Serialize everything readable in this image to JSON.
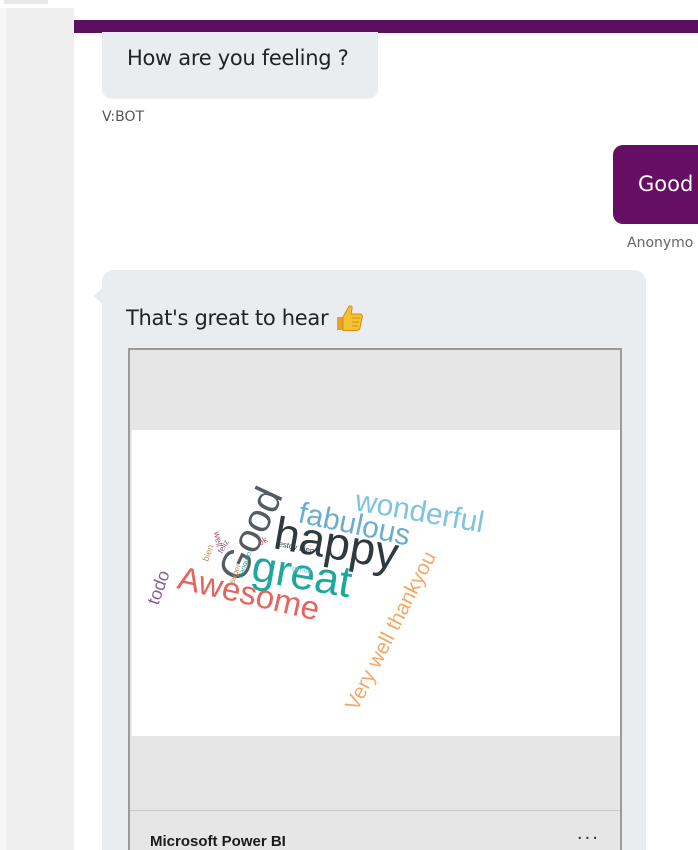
{
  "colors": {
    "accent": "#5b0f5e",
    "user_bubble": "#660e63",
    "bot_bubble": "#eaedf0"
  },
  "conversation": {
    "bot_message_1": "How are you feeling ?",
    "bot_label": "V:BOT",
    "user_message": "Good",
    "user_label": "Anonymo",
    "bot_message_2": "That's great to hear",
    "bot_message_2_icon": "thumbs-up-icon"
  },
  "card": {
    "title": "Microsoft Power BI",
    "more_label": "···"
  },
  "wordcloud": {
    "words": [
      {
        "text": "wonderful",
        "color": "#7fc4df"
      },
      {
        "text": "fabulous",
        "color": "#6aaecf"
      },
      {
        "text": "happy",
        "color": "#2d3a40"
      },
      {
        "text": "Good",
        "color": "#555c61"
      },
      {
        "text": "great",
        "color": "#1ea79b"
      },
      {
        "text": "Awesome",
        "color": "#e4645f"
      },
      {
        "text": "todo",
        "color": "#8a5e96"
      },
      {
        "text": "Very well thankyou",
        "color": "#f2a96a"
      },
      {
        "text": "bien",
        "color": "#c98c5a"
      },
      {
        "text": "well",
        "color": "#b4506e"
      },
      {
        "text": "feliz",
        "color": "#8a5e96"
      },
      {
        "text": "estoy bien",
        "color": "#2d3a40"
      },
      {
        "text": "genial",
        "color": "#7fc4df"
      },
      {
        "text": "tranquilo",
        "color": "#1ea79b"
      },
      {
        "text": "ok",
        "color": "#b4506e"
      },
      {
        "text": "super",
        "color": "#c98c5a"
      }
    ]
  }
}
